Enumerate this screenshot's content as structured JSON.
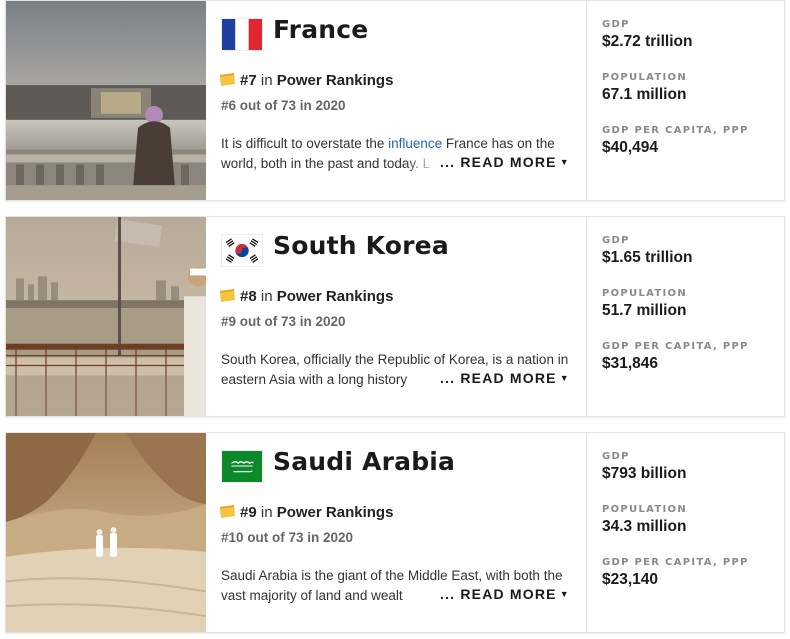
{
  "countries": [
    {
      "name": "France",
      "flag_icon": "france-flag-icon",
      "rank": "#7",
      "rank_in": "in",
      "rank_label": "Power Rankings",
      "prev_rank": "#6 out of 73 in 2020",
      "desc_before": "It is difficult to overstate the ",
      "desc_link": "influence",
      "desc_after": " France has on the world, both in the past and today. L",
      "read_more": "... READ MORE",
      "stats": {
        "gdp_label": "GDP",
        "gdp": "$2.72 trillion",
        "pop_label": "POPULATION",
        "pop": "67.1 million",
        "pc_label": "GDP PER CAPITA, PPP",
        "pc": "$40,494"
      }
    },
    {
      "name": "South Korea",
      "flag_icon": "south-korea-flag-icon",
      "rank": "#8",
      "rank_in": "in",
      "rank_label": "Power Rankings",
      "prev_rank": "#9 out of 73 in 2020",
      "desc_before": "South Korea, officially the Republic of Korea, is a nation in eastern Asia with a long history ",
      "desc_link": "",
      "desc_after": "",
      "read_more": "... READ MORE",
      "stats": {
        "gdp_label": "GDP",
        "gdp": "$1.65 trillion",
        "pop_label": "POPULATION",
        "pop": "51.7 million",
        "pc_label": "GDP PER CAPITA, PPP",
        "pc": "$31,846"
      }
    },
    {
      "name": "Saudi Arabia",
      "flag_icon": "saudi-arabia-flag-icon",
      "rank": "#9",
      "rank_in": "in",
      "rank_label": "Power Rankings",
      "prev_rank": "#10 out of 73 in 2020",
      "desc_before": "Saudi Arabia is the giant of the Middle East, with both the vast majority of land and wealt",
      "desc_link": "",
      "desc_after": "",
      "read_more": "... READ MORE",
      "stats": {
        "gdp_label": "GDP",
        "gdp": "$793 billion",
        "pop_label": "POPULATION",
        "pop": "34.3 million",
        "pc_label": "GDP PER CAPITA, PPP",
        "pc": "$23,140"
      }
    }
  ],
  "colors": {
    "link": "#2866b8",
    "badge": "#f5c242",
    "label_gray": "#8a8a8a"
  }
}
